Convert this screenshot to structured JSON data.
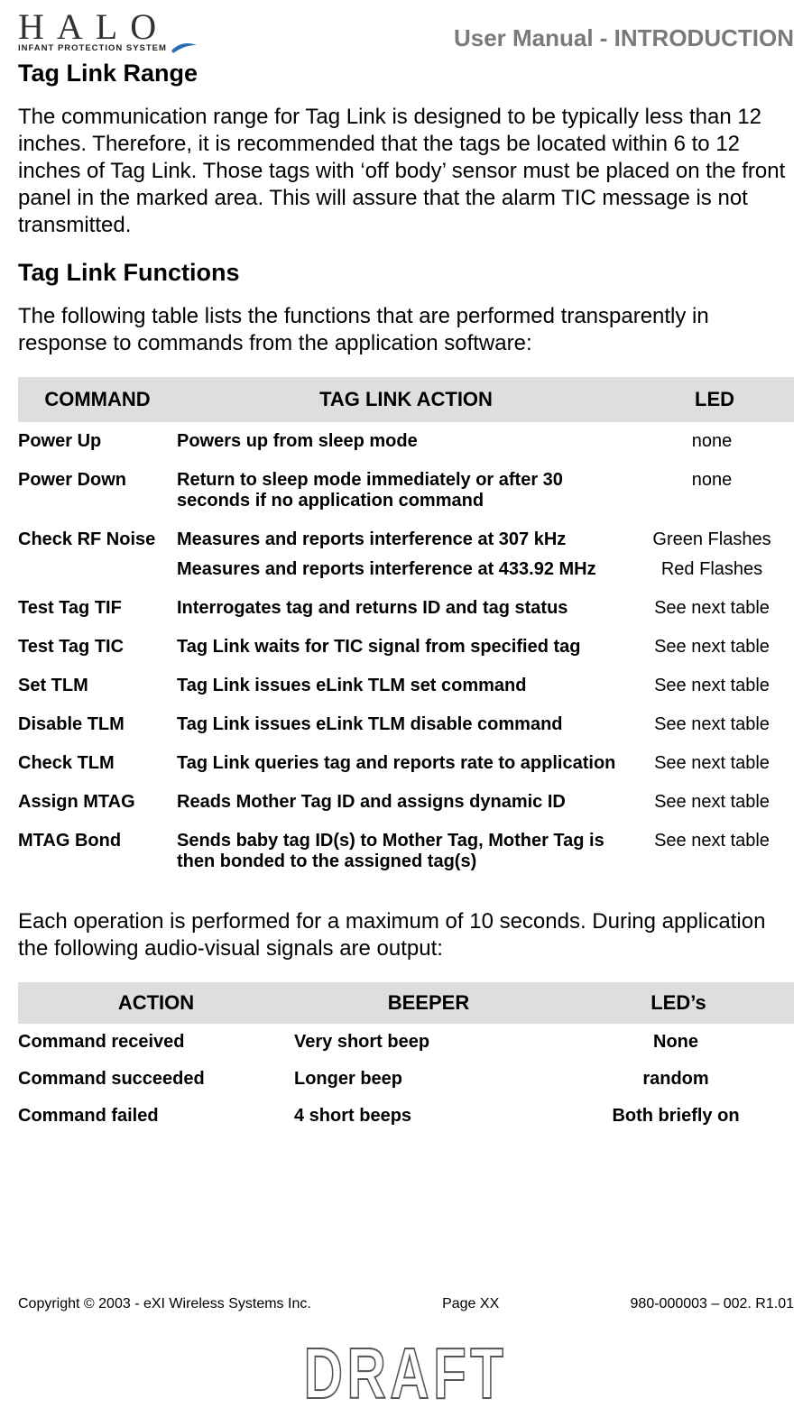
{
  "logo": {
    "main": "HALO",
    "sub": "INFANT PROTECTION SYSTEM"
  },
  "header": {
    "right": "User Manual - INTRODUCTION"
  },
  "sections": {
    "range_title": "Tag Link Range",
    "range_body": "The communication range for Tag Link is designed to be typically less than 12 inches.  Therefore, it is recommended that the tags be located within 6 to 12 inches of Tag Link.  Those tags with ‘off body’ sensor must be placed on the front panel in the marked area.  This will assure that the alarm TIC message is not transmitted.",
    "functions_title": "Tag Link Functions",
    "functions_intro": "The following table lists the functions that are performed transparently in response to commands from the application software:",
    "after_table": "Each operation is performed for a maximum of 10 seconds.  During application the following audio-visual signals are output:"
  },
  "functions_table": {
    "headers": {
      "command": "COMMAND",
      "action": "TAG LINK ACTION",
      "led": "LED"
    },
    "rows": [
      {
        "command": "Power Up",
        "action": "Powers up from sleep mode",
        "led": "none"
      },
      {
        "command": "Power Down",
        "action": "Return to sleep mode immediately or after 30 seconds if no application command",
        "led": "none"
      },
      {
        "command": "Check RF Noise",
        "action": "Measures and reports interference  at 307 kHz",
        "led": "Green Flashes"
      },
      {
        "command": "",
        "action": "Measures and reports interference  at 433.92 MHz",
        "led": "Red Flashes"
      },
      {
        "command": "Test Tag TIF",
        "action": "Interrogates tag and returns ID and tag status",
        "led": "See next table"
      },
      {
        "command": "Test Tag TIC",
        "action": "Tag Link waits for TIC signal from specified tag",
        "led": "See next table"
      },
      {
        "command": "Set TLM",
        "action": "Tag Link issues eLink TLM set command",
        "led": "See next table"
      },
      {
        "command": "Disable TLM",
        "action": "Tag Link issues eLink TLM disable command",
        "led": "See next table"
      },
      {
        "command": "Check TLM",
        "action": "Tag Link queries tag and reports rate to application",
        "led": "See next table"
      },
      {
        "command": "Assign MTAG",
        "action": "Reads Mother Tag ID and assigns dynamic ID",
        "led": "See next table"
      },
      {
        "command": "MTAG Bond",
        "action": "Sends baby tag ID(s) to Mother Tag, Mother Tag is then bonded to the assigned tag(s)",
        "led": "See next table"
      }
    ]
  },
  "signals_table": {
    "headers": {
      "action": "ACTION",
      "beeper": "BEEPER",
      "leds": "LED’s"
    },
    "rows": [
      {
        "action": "Command received",
        "beeper": "Very short beep",
        "leds": "None"
      },
      {
        "action": "Command succeeded",
        "beeper": "Longer beep",
        "leds": "random"
      },
      {
        "action": "Command failed",
        "beeper": "4 short beeps",
        "leds": "Both briefly on"
      }
    ]
  },
  "footer": {
    "left": "Copyright © 2003 - eXI Wireless Systems Inc.",
    "center": "Page XX",
    "right": "980-000003 – 002. R1.01"
  },
  "watermark": "DRAFT"
}
